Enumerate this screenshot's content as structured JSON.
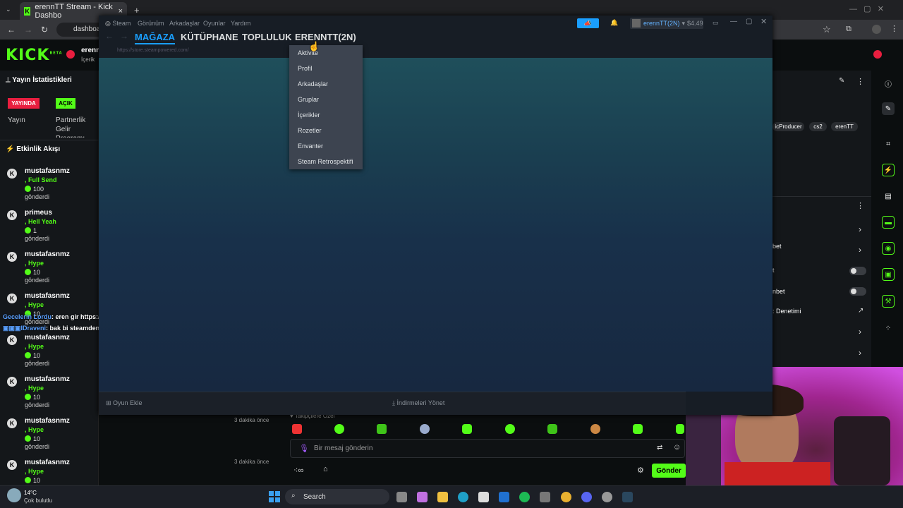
{
  "browser": {
    "tab_title": "erennTT Stream - Kick Dashbo",
    "tab_close": "×",
    "new_tab": "+",
    "address": "dashboa"
  },
  "kick": {
    "logo": "KICK",
    "logo_beta": "BETA",
    "user_short": "erenn",
    "user_sub": "İçerik",
    "stream_stats_title": "Yayın İstatistikleri",
    "badge_live": "YAYINDA",
    "badge_open": "AÇIK",
    "stat_stream": "Yayın",
    "stat_partner_1": "Partnerlik",
    "stat_partner_2": "Gelir",
    "stat_partner_3": "Programı",
    "activity_title": "Etkinlik Akışı",
    "feed": [
      {
        "user": "mustafasnmz",
        "gift": ", Full Send",
        "amount": "100",
        "sent": "gönderdi"
      },
      {
        "user": "primeus",
        "gift": ", Hell Yeah",
        "amount": "1",
        "sent": "gönderdi"
      },
      {
        "user": "mustafasnmz",
        "gift": ", Hype",
        "amount": "10",
        "sent": "gönderdi"
      },
      {
        "user": "mustafasnmz",
        "gift": ", Hype",
        "amount": "10",
        "sent": "gönderdi"
      },
      {
        "user": "mustafasnmz",
        "gift": ", Hype",
        "amount": "10",
        "sent": "gönderdi"
      },
      {
        "user": "mustafasnmz",
        "gift": ", Hype",
        "amount": "10",
        "sent": "gönderdi"
      },
      {
        "user": "mustafasnmz",
        "gift": ", Hype",
        "amount": "10",
        "sent": "gönderdi"
      },
      {
        "user": "mustafasnmz",
        "gift": ", Hype",
        "amount": "10",
        "sent": "gönderdi"
      }
    ],
    "time_ago_1": "3 dakika önce",
    "time_ago_2": "3 dakika önce",
    "overlay_chat": [
      {
        "user": "Gecelerin Lordu",
        "text": ": eren gir https://www.parolla.app/"
      },
      {
        "user": "IDraveni",
        "text": ": bak bi steamden"
      }
    ],
    "followers_only": "Takipçilere Özel",
    "chat_placeholder": "Bir mesaj gönderin",
    "send_label": "Gönder",
    "tags": [
      "icProducer",
      "cs2",
      "erenTT"
    ],
    "right_labels": [
      "bet",
      "t",
      "nbet",
      ": Denetimi"
    ]
  },
  "steam": {
    "menu": [
      "Steam",
      "Görünüm",
      "Arkadaşlar",
      "Oyunlar",
      "Yardım"
    ],
    "nav": [
      "MAĞAZA",
      "KÜTÜPHANE",
      "TOPLULUK",
      "ERENNTT(2N)"
    ],
    "url": "https://store.steampowered.com/",
    "account": "erennTT(2N)",
    "balance": "$4.49",
    "dropdown": [
      "Aktivite",
      "Profil",
      "Arkadaşlar",
      "Gruplar",
      "İçerikler",
      "Rozetler",
      "Envanter",
      "Steam Retrospektifi"
    ],
    "add_game": "Oyun Ekle",
    "manage_downloads": "İndirmeleri Yönet"
  },
  "taskbar": {
    "weather_temp": "14°C",
    "weather_desc": "Çok bulutlu",
    "search": "Search"
  },
  "colors": {
    "kick_green": "#53fc18",
    "steam_blue": "#1a9fff",
    "live_red": "#e91e3f"
  }
}
